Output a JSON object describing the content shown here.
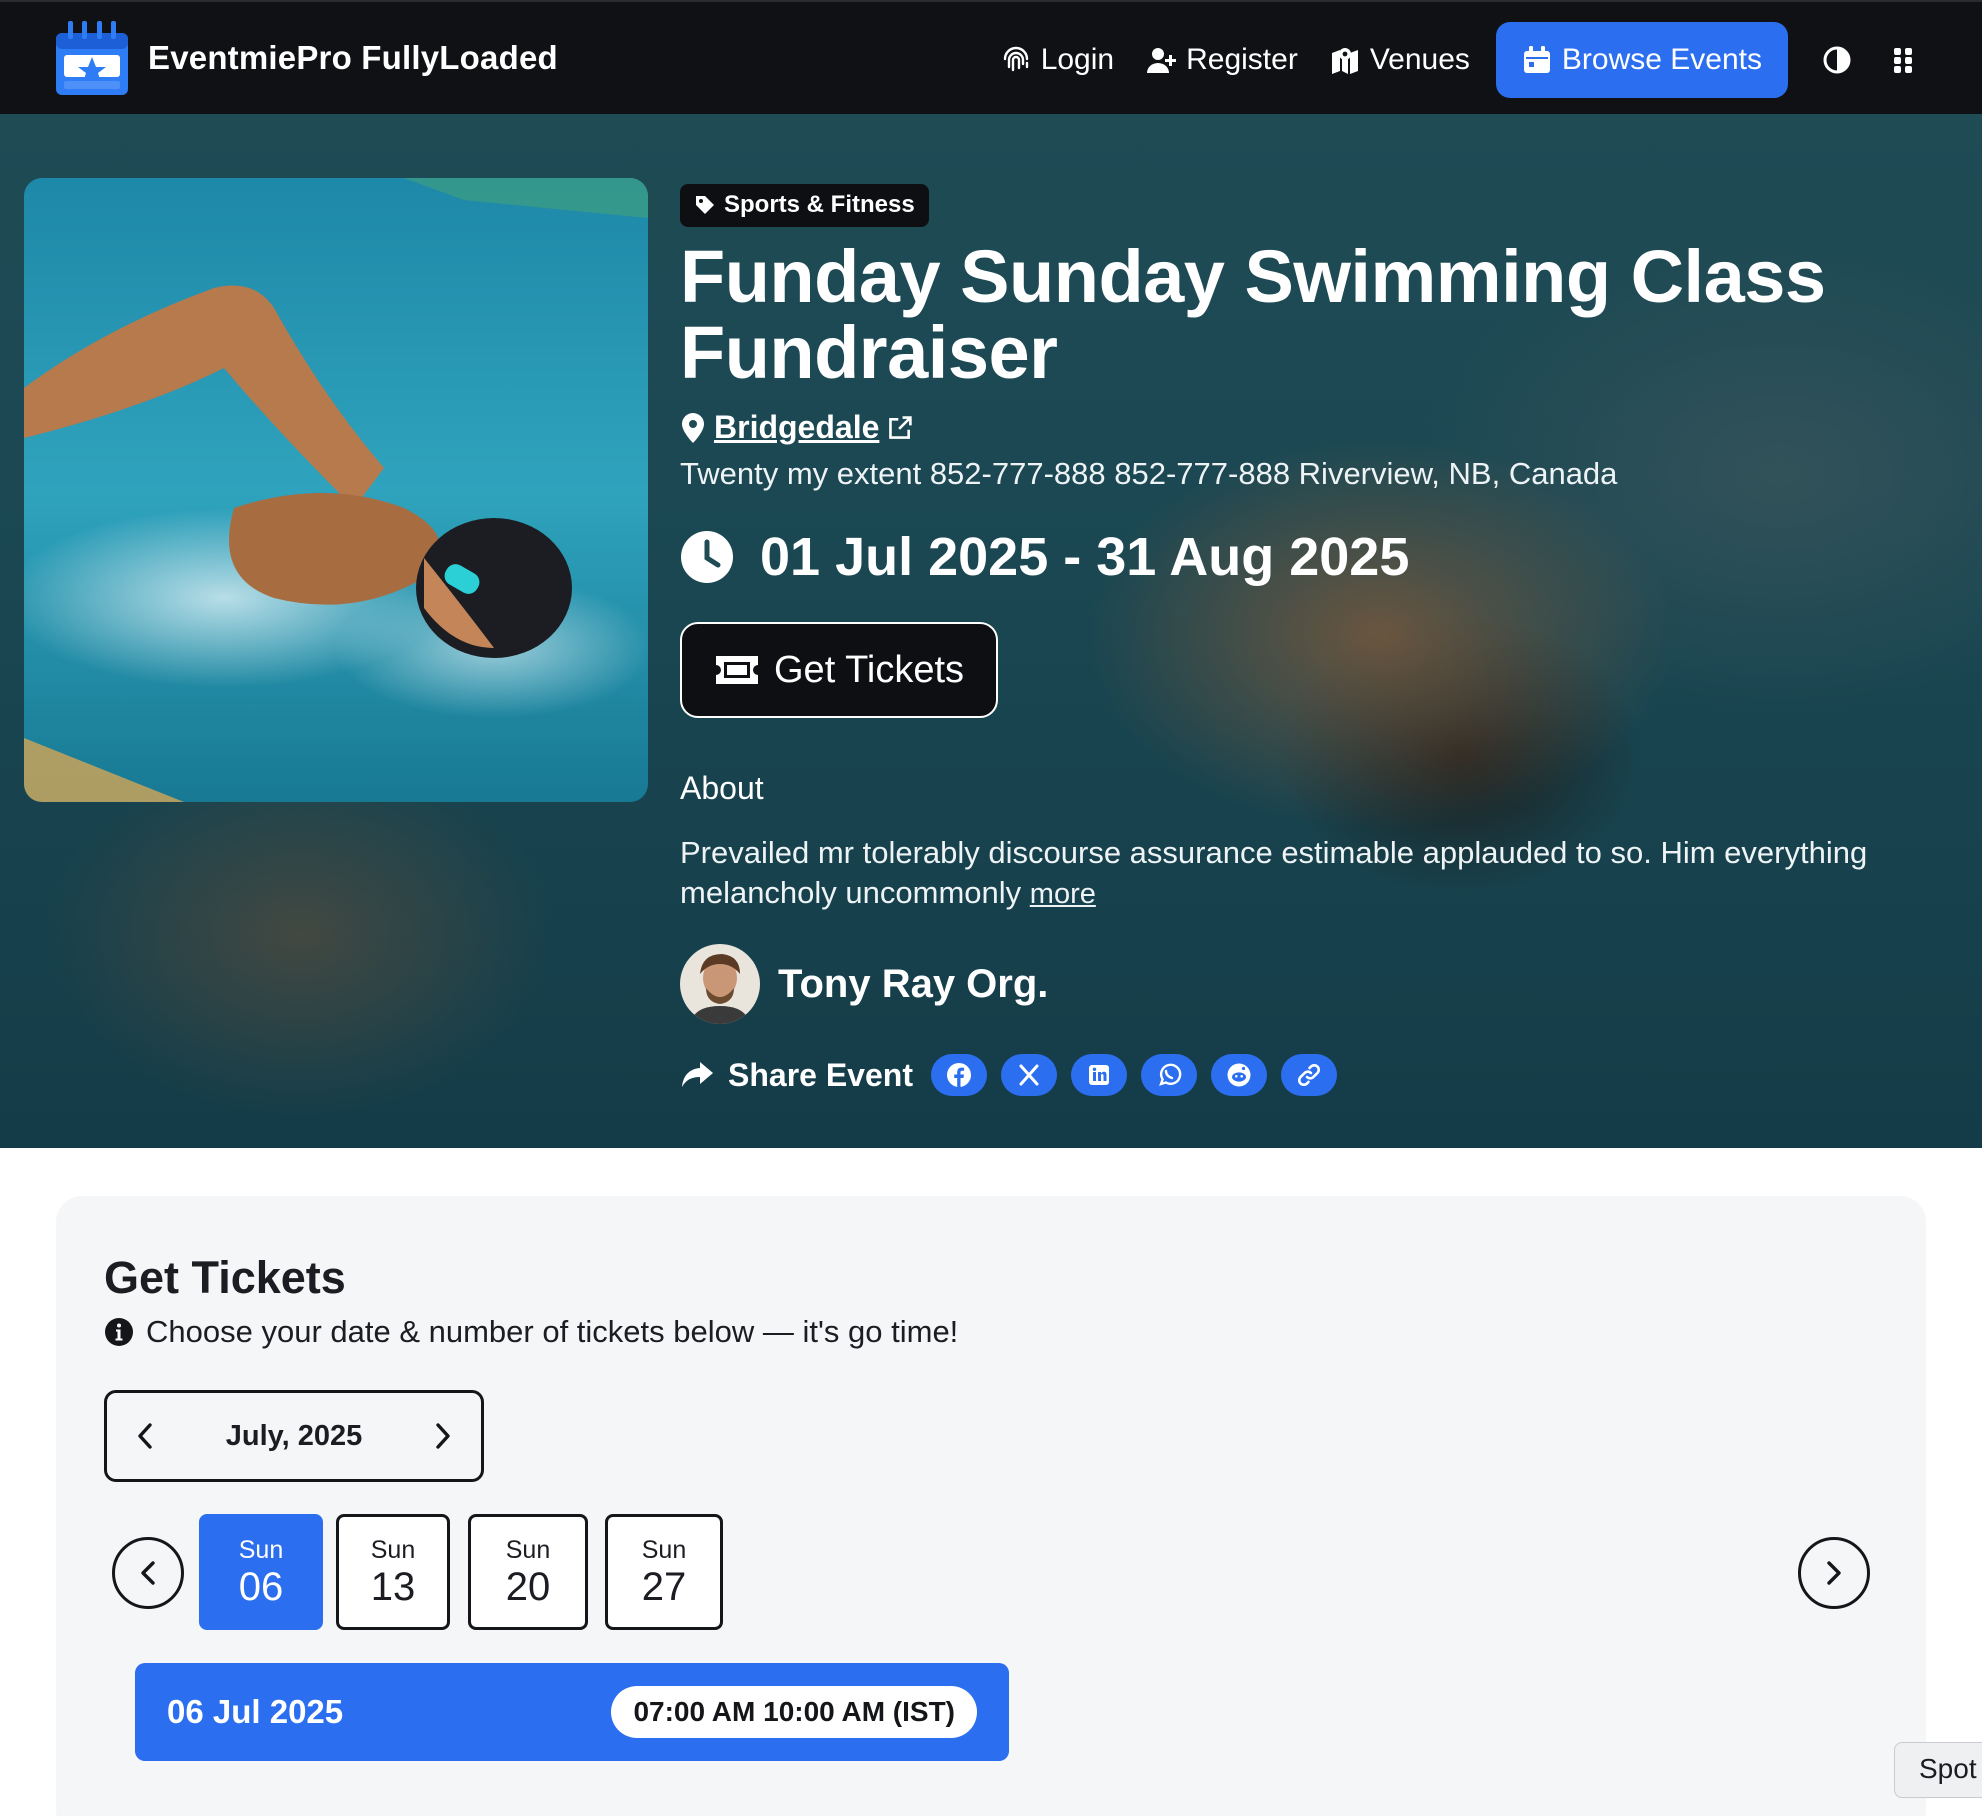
{
  "nav": {
    "brand": "EventmiePro FullyLoaded",
    "links": [
      {
        "label": "Login",
        "icon": "fingerprint-icon"
      },
      {
        "label": "Register",
        "icon": "user-plus-icon"
      },
      {
        "label": "Venues",
        "icon": "map-icon"
      },
      {
        "label": "Browse Events",
        "icon": "calendar-icon"
      }
    ],
    "theme_icon": "half-circle-icon",
    "menu_icon": "grid-dots-icon",
    "accent_color": "#2b6ff0"
  },
  "event": {
    "category": "Sports & Fitness",
    "title": "Funday Sunday Swimming Class Fundraiser",
    "venue": "Bridgedale",
    "address": "Twenty my extent 852-777-888 852-777-888 Riverview, NB, Canada",
    "dates": "01 Jul 2025 - 31 Aug 2025",
    "get_tickets_label": "Get Tickets",
    "about_heading": "About",
    "about_text": "Prevailed mr tolerably discourse assurance estimable applauded to so. Him everything melancholy uncommonly",
    "more_label": "more",
    "organizer": "Tony Ray Org.",
    "share_label": "Share Event",
    "share_icons": [
      "facebook-icon",
      "x-icon",
      "linkedin-icon",
      "whatsapp-icon",
      "reddit-icon",
      "link-icon"
    ]
  },
  "tickets": {
    "title": "Get Tickets",
    "subtitle": "Choose your date & number of tickets below — it's go time!",
    "month": "July, 2025",
    "days": [
      {
        "dow": "Sun",
        "num": "06",
        "selected": true
      },
      {
        "dow": "Sun",
        "num": "13",
        "selected": false
      },
      {
        "dow": "Sun",
        "num": "20",
        "selected": false
      },
      {
        "dow": "Sun",
        "num": "27",
        "selected": false
      }
    ],
    "slot_date": "06 Jul 2025",
    "slot_time": "07:00 AM 10:00 AM (IST)"
  },
  "spot_tab": "Spot"
}
